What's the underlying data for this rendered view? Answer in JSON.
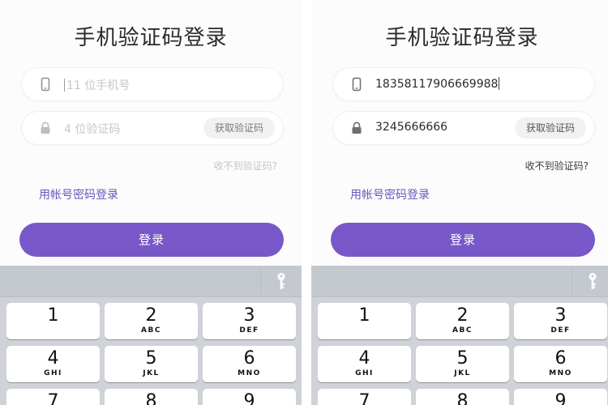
{
  "screens": [
    {
      "title": "手机验证码登录",
      "phone_placeholder": "11 位手机号",
      "code_placeholder": "4 位验证码",
      "get_code": "获取验证码",
      "no_code": "收不到验证码?",
      "password_login": "用帐号密码登录",
      "login": "登录"
    },
    {
      "title": "手机验证码登录",
      "phone_value": "18358117906669988",
      "code_value": "3245666666",
      "get_code": "获取验证码",
      "no_code": "收不到验证码?",
      "password_login": "用帐号密码登录",
      "login": "登录"
    }
  ],
  "keypad": [
    {
      "num": "1",
      "letters": ""
    },
    {
      "num": "2",
      "letters": "ABC"
    },
    {
      "num": "3",
      "letters": "DEF"
    },
    {
      "num": "4",
      "letters": "GHI"
    },
    {
      "num": "5",
      "letters": "JKL"
    },
    {
      "num": "6",
      "letters": "MNO"
    },
    {
      "num": "7",
      "letters": ""
    },
    {
      "num": "8",
      "letters": ""
    },
    {
      "num": "9",
      "letters": ""
    }
  ],
  "colors": {
    "accent": "#7858c8",
    "link": "#6a56b8",
    "keyboard_bg": "#cfd2d8"
  },
  "icons": {
    "phone": "phone-icon",
    "lock": "lock-icon",
    "key": "key-icon"
  }
}
